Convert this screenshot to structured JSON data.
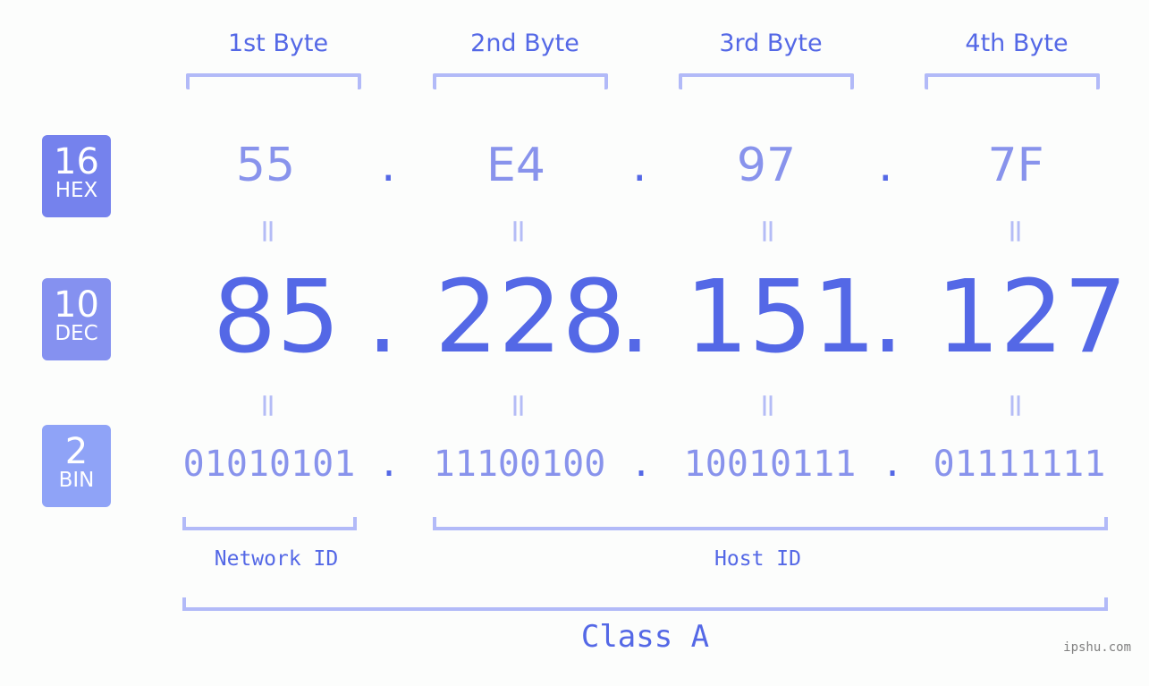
{
  "bytes": {
    "headers": [
      "1st Byte",
      "2nd Byte",
      "3rd Byte",
      "4th Byte"
    ],
    "hex": [
      "55",
      "E4",
      "97",
      "7F"
    ],
    "dec": [
      "85",
      "228",
      "151",
      "127"
    ],
    "bin": [
      "01010101",
      "11100100",
      "10010111",
      "01111111"
    ]
  },
  "separator": ".",
  "equals": "=",
  "badges": {
    "hex": {
      "num": "16",
      "label": "HEX",
      "color": "#7582ed"
    },
    "dec": {
      "num": "10",
      "label": "DEC",
      "color": "#8591f0"
    },
    "bin": {
      "num": "2",
      "label": "BIN",
      "color": "#8fa3f7"
    }
  },
  "segments": {
    "network": "Network ID",
    "host": "Host ID",
    "class": "Class A"
  },
  "watermark": "ipshu.com",
  "colors": {
    "primary": "#5468e6",
    "light": "#8893ec",
    "bracket": "#b2baf8",
    "background": "#fcfdfc"
  }
}
